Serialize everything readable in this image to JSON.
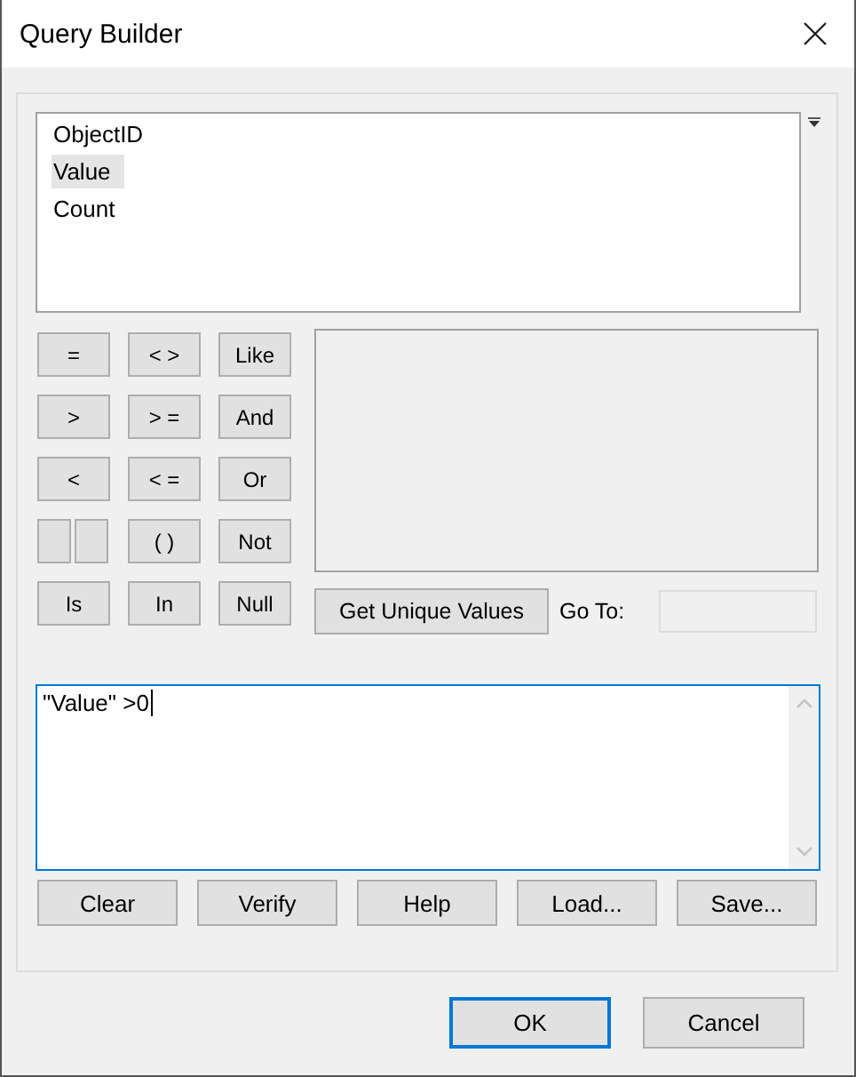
{
  "window": {
    "title": "Query Builder"
  },
  "fields": [
    {
      "name": "ObjectID",
      "selected": false
    },
    {
      "name": "Value",
      "selected": true
    },
    {
      "name": "Count",
      "selected": false
    }
  ],
  "operators": [
    [
      {
        "kind": "text",
        "label": "="
      },
      {
        "kind": "text",
        "label": "< >"
      },
      {
        "kind": "text",
        "label": "Like"
      }
    ],
    [
      {
        "kind": "text",
        "label": ">"
      },
      {
        "kind": "text",
        "label": "> ="
      },
      {
        "kind": "text",
        "label": "And"
      }
    ],
    [
      {
        "kind": "text",
        "label": "<"
      },
      {
        "kind": "text",
        "label": "< ="
      },
      {
        "kind": "text",
        "label": "Or"
      }
    ],
    [
      {
        "kind": "blank-pair"
      },
      {
        "kind": "text",
        "label": "( )"
      },
      {
        "kind": "text",
        "label": "Not"
      }
    ],
    [
      {
        "kind": "text",
        "label": "Is"
      },
      {
        "kind": "text",
        "label": "In"
      },
      {
        "kind": "text",
        "label": "Null"
      }
    ]
  ],
  "unique_values_button": "Get Unique Values",
  "goto": {
    "label": "Go To:",
    "disabled": true
  },
  "expression": {
    "value": "\"Value\" >0",
    "focused": true
  },
  "expression_buttons": [
    "Clear",
    "Verify",
    "Help",
    "Load...",
    "Save..."
  ],
  "dialog_buttons": [
    {
      "label": "OK",
      "default": true
    },
    {
      "label": "Cancel",
      "default": false
    }
  ]
}
